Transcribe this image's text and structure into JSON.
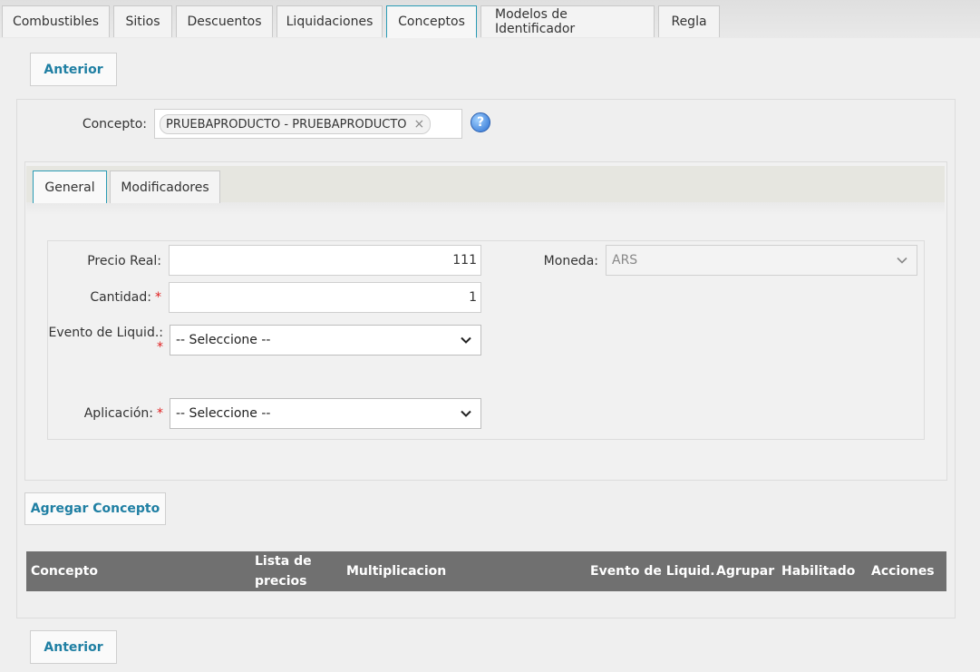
{
  "top_tabs": [
    {
      "label": "Combustibles",
      "active": false
    },
    {
      "label": "Sitios",
      "active": false
    },
    {
      "label": "Descuentos",
      "active": false
    },
    {
      "label": "Liquidaciones",
      "active": false
    },
    {
      "label": "Conceptos",
      "active": true
    },
    {
      "label": "Modelos de Identificador",
      "active": false
    },
    {
      "label": "Regla",
      "active": false
    }
  ],
  "buttons": {
    "anterior_top": "Anterior",
    "agregar_concepto": "Agregar Concepto",
    "anterior_bottom": "Anterior"
  },
  "concepto": {
    "label": "Concepto:",
    "tag": "PRUEBAPRODUCTO - PRUEBAPRODUCTO",
    "tag_remove": "×",
    "help": "?"
  },
  "inner_tabs": [
    {
      "label": "General",
      "active": true
    },
    {
      "label": "Modificadores",
      "active": false
    }
  ],
  "form": {
    "precio_real": {
      "label": "Precio Real:",
      "value": "111"
    },
    "cantidad": {
      "label": "Cantidad:",
      "required": "*",
      "value": "1"
    },
    "evento_liquid": {
      "label": "Evento de Liquid.:",
      "required": "*",
      "value": "-- Seleccione --"
    },
    "aplicacion": {
      "label": "Aplicación:",
      "required": "*",
      "value": "-- Seleccione --"
    },
    "moneda": {
      "label": "Moneda:",
      "value": "ARS"
    }
  },
  "table": {
    "headers": {
      "concepto": "Concepto",
      "lista_line1": "Lista de",
      "lista_line2": "precios",
      "multiplicacion": "Multiplicacion",
      "evento": "Evento de Liquid.",
      "agrupar": "Agrupar",
      "habilitado": "Habilitado",
      "acciones": "Acciones"
    }
  },
  "colors": {
    "accent": "#2a9bb5",
    "button_text": "#1f7fa3",
    "table_header": "#707070",
    "required": "#e02020"
  }
}
